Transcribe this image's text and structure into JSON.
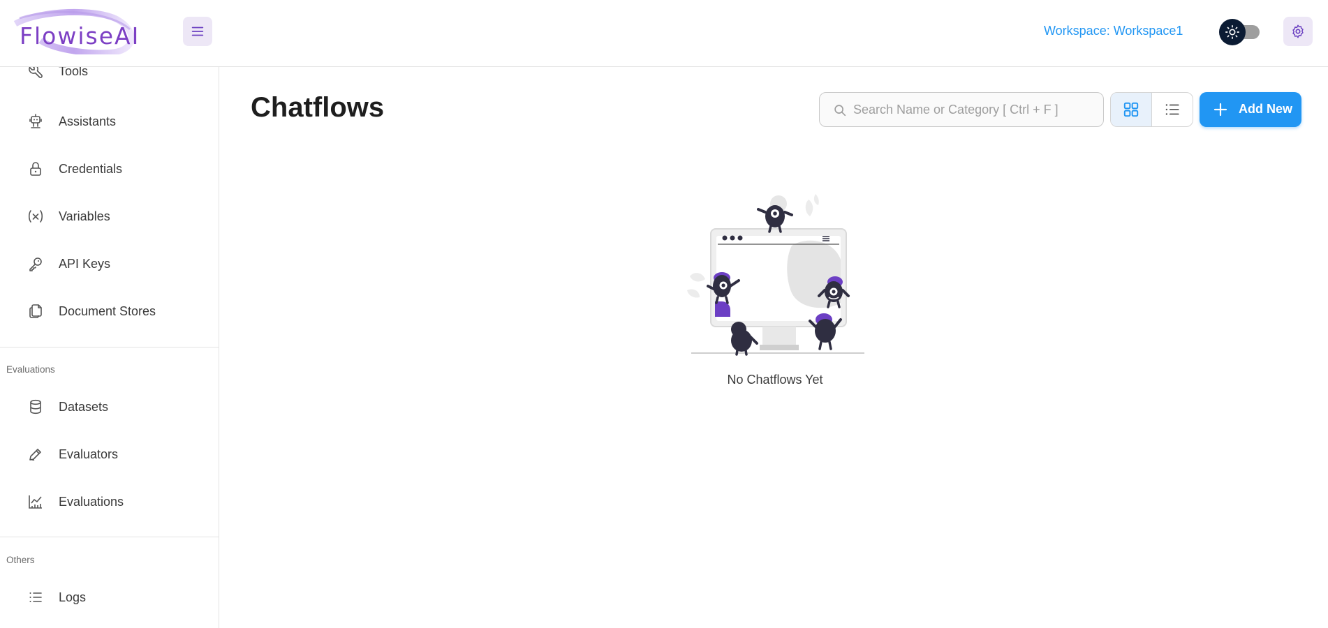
{
  "header": {
    "logo_text": "FlowiseAI",
    "workspace_label": "Workspace: Workspace1",
    "theme_mode": "dark",
    "brand_color": "#7c3fc4",
    "accent_color": "#2196f3"
  },
  "sidebar": {
    "items": [
      {
        "label": "Tools",
        "icon": "tool-icon"
      },
      {
        "label": "Assistants",
        "icon": "robot-icon"
      },
      {
        "label": "Credentials",
        "icon": "lock-icon"
      },
      {
        "label": "Variables",
        "icon": "variable-icon"
      },
      {
        "label": "API Keys",
        "icon": "key-icon"
      },
      {
        "label": "Document Stores",
        "icon": "files-icon"
      }
    ],
    "sections": [
      {
        "title": "Evaluations",
        "items": [
          {
            "label": "Datasets",
            "icon": "database-icon"
          },
          {
            "label": "Evaluators",
            "icon": "pencil-icon"
          },
          {
            "label": "Evaluations",
            "icon": "chart-icon"
          }
        ]
      },
      {
        "title": "Others",
        "items": [
          {
            "label": "Logs",
            "icon": "list-icon"
          }
        ]
      }
    ]
  },
  "main": {
    "title": "Chatflows",
    "search": {
      "placeholder": "Search Name or Category [ Ctrl + F ]",
      "value": ""
    },
    "view_toggle": {
      "selected": "card",
      "options": [
        "card",
        "list"
      ]
    },
    "add_button_label": "Add New",
    "empty_state_text": "No Chatflows Yet"
  }
}
